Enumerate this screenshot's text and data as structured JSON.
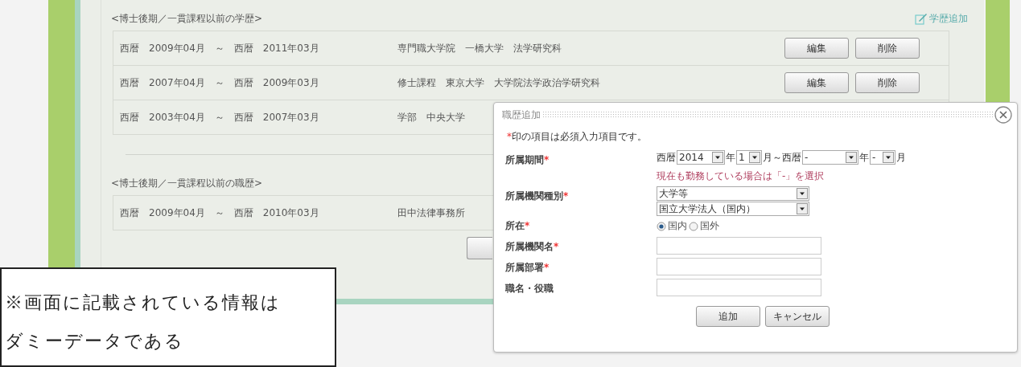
{
  "education": {
    "heading": "<博士後期／一貫課程以前の学歴>",
    "add_link": "学歴追加",
    "rows": [
      {
        "period": "西暦　2009年04月　～　西暦　2011年03月",
        "institution": "専門職大学院　一橋大学　法学研究科",
        "buttons": [
          "編集",
          "削除"
        ]
      },
      {
        "period": "西暦　2007年04月　～　西暦　2009年03月",
        "institution": "修士課程　東京大学　大学院法学政治学研究科",
        "buttons": [
          "編集",
          "削除"
        ]
      },
      {
        "period": "西暦　2003年04月　～　西暦　2007年03月",
        "institution": "学部　中央大学"
      }
    ]
  },
  "career": {
    "heading": "<博士後期／一貫課程以前の職歴>",
    "rows": [
      {
        "period": "西暦　2009年04月　～　西暦　2010年03月",
        "institution": "田中法律事務所"
      }
    ]
  },
  "dialog": {
    "title": "職歴追加",
    "note_mark": "*",
    "note": "印の項目は必須入力項目です。",
    "fields": [
      {
        "kind": "period",
        "label": "所属期間",
        "required_mark": "*",
        "parts": [
          {
            "kind": "text",
            "text": "西暦"
          },
          {
            "kind": "select",
            "value": "2014"
          },
          {
            "kind": "text",
            "text": "年"
          },
          {
            "kind": "select",
            "value": "1"
          },
          {
            "kind": "text",
            "text": "月～西暦"
          },
          {
            "kind": "select",
            "value": "-"
          },
          {
            "kind": "text",
            "text": "年"
          },
          {
            "kind": "select",
            "value": "-"
          },
          {
            "kind": "text",
            "text": "月"
          }
        ],
        "hint": "現在も勤務している場合は「-」を選択"
      },
      {
        "kind": "selects",
        "label": "所属機関種別",
        "required_mark": "*",
        "selects": [
          "大学等",
          "国立大学法人（国内）"
        ]
      },
      {
        "kind": "radio",
        "label": "所在",
        "required_mark": "*",
        "options": [
          {
            "label": "国内",
            "selected": true
          },
          {
            "label": "国外",
            "selected": false
          }
        ]
      },
      {
        "kind": "text",
        "label": "所属機関名",
        "required_mark": "*"
      },
      {
        "kind": "text",
        "label": "所属部署",
        "required_mark": "*"
      },
      {
        "kind": "text",
        "label": "職名・役職"
      }
    ],
    "buttons": [
      "追加",
      "キャンセル"
    ]
  },
  "note": {
    "lines": [
      "※画面に記載されている情報は",
      "ダミーデータである"
    ]
  }
}
